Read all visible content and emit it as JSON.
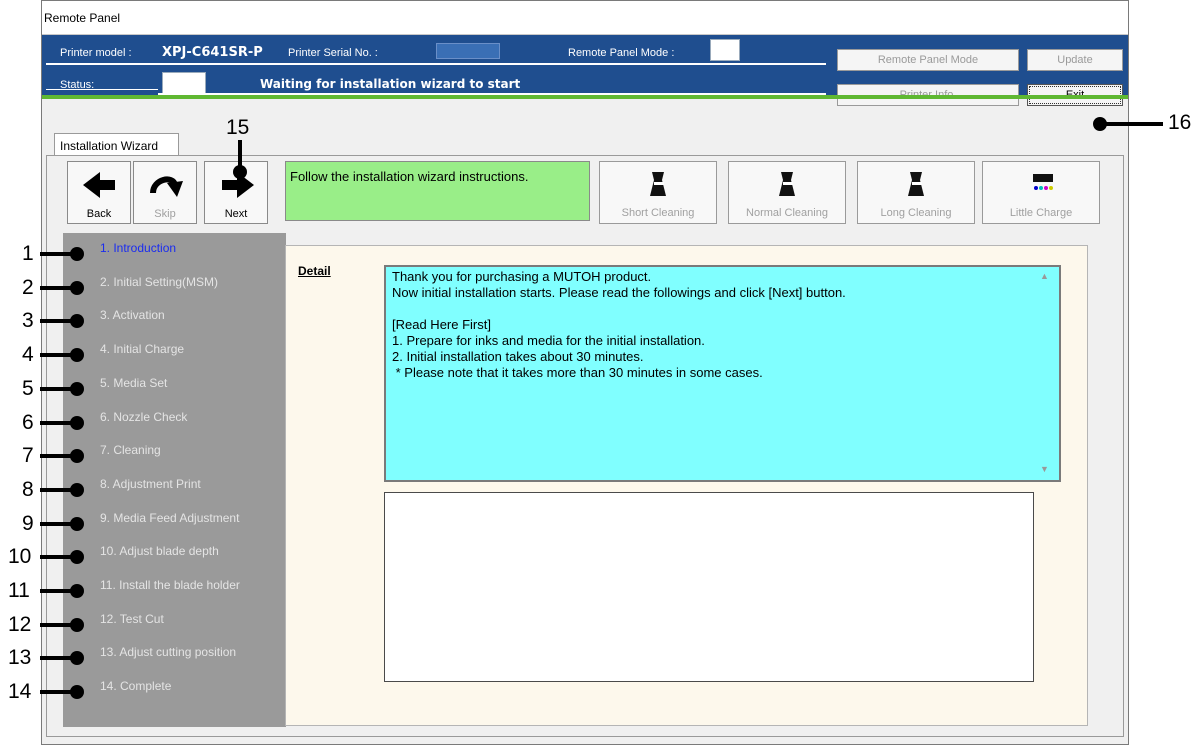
{
  "window": {
    "title": "Remote Panel"
  },
  "header": {
    "printer_model_label": "Printer model :",
    "printer_model": "XPJ-C641SR-P",
    "serial_label": "Printer Serial No. :",
    "mode_label": "Remote Panel Mode :",
    "status_label": "Status:",
    "status_text": "Waiting for installation wizard to start",
    "buttons": {
      "remote_panel_mode": "Remote Panel Mode",
      "update": "Update",
      "printer_info": "Printer Info.",
      "exit": "Exit"
    }
  },
  "tab": {
    "label": "Installation Wizard"
  },
  "toolbar": {
    "back": "Back",
    "skip": "Skip",
    "next": "Next",
    "instruction": "Follow the installation wizard instructions.",
    "cleaning": [
      "Short Cleaning",
      "Normal Cleaning",
      "Long Cleaning",
      "Little Charge"
    ]
  },
  "steps": [
    "1. Introduction",
    "2. Initial Setting(MSM)",
    "3. Activation",
    "4. Initial Charge",
    "5. Media Set",
    "6. Nozzle Check",
    "7. Cleaning",
    "8. Adjustment Print",
    "9. Media Feed Adjustment",
    "10. Adjust blade depth",
    "11. Install the blade holder",
    "12. Test Cut",
    "13. Adjust cutting position",
    "14. Complete"
  ],
  "active_step": 0,
  "detail": {
    "label": "Detail",
    "text": "Thank you for purchasing a MUTOH product.\nNow initial installation starts. Please read the followings and click [Next] button.\n\n[Read Here First]\n1. Prepare for inks and media for the initial installation.\n2. Initial installation takes about 30 minutes.\n * Please note that it takes more than 30 minutes in some cases."
  },
  "callouts": [
    "1",
    "2",
    "3",
    "4",
    "5",
    "6",
    "7",
    "8",
    "9",
    "10",
    "11",
    "12",
    "13",
    "14",
    "15",
    "16"
  ],
  "colors": {
    "header_blue": "#1f4e8f",
    "accent_green": "#5fb832",
    "instruction_bg": "#99ee88",
    "detail_bg": "#80ffff",
    "active_step": "#1a2cf0"
  }
}
